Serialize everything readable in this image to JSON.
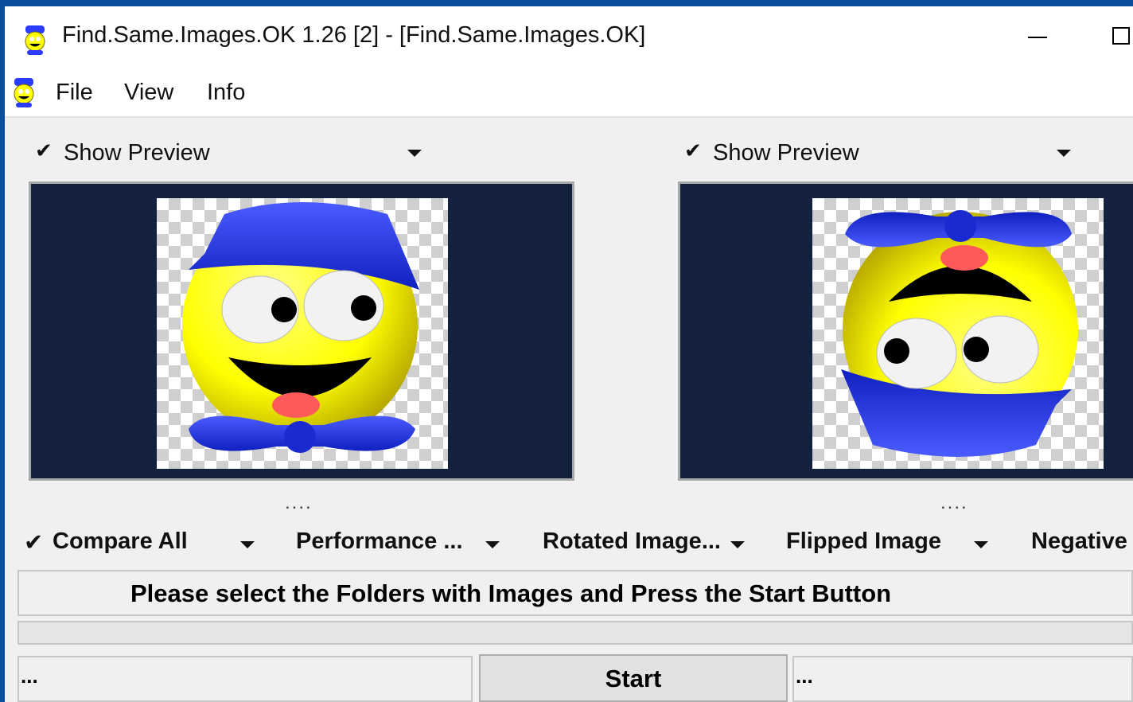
{
  "window": {
    "title": "Find.Same.Images.OK 1.26 [2] - [Find.Same.Images.OK]",
    "app_icon": "smiley-app-icon",
    "controls": [
      "minimize-icon",
      "maximize-icon"
    ]
  },
  "menu": {
    "items": [
      {
        "label": "File"
      },
      {
        "label": "View"
      },
      {
        "label": "Info"
      }
    ]
  },
  "previews": [
    {
      "check": "✔",
      "label": "Show Preview",
      "dots": "...."
    },
    {
      "check": "✔",
      "label": "Show Preview",
      "dots": "...."
    }
  ],
  "options": [
    {
      "check": "✔",
      "label": "Compare All"
    },
    {
      "label": "Performance ..."
    },
    {
      "label": "Rotated Image..."
    },
    {
      "label": "Flipped Image"
    },
    {
      "label": "Negative"
    }
  ],
  "status": {
    "message": "Please select the Folders with Images and Press the Start Button"
  },
  "bottom": {
    "left_field": "...",
    "start_label": "Start",
    "right_field": "..."
  },
  "colors": {
    "preview_bg": "#13203f",
    "smiley_yellow": "#ffff00",
    "hat_blue": "#2a3cff",
    "frame_blue": "#0a4f9e"
  }
}
